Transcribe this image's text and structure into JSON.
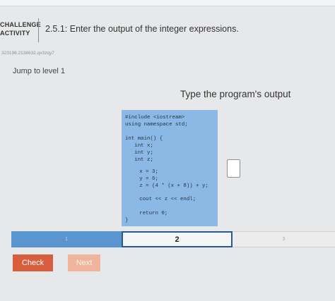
{
  "header": {
    "activity_type_line1": "CHALLENGE",
    "activity_type_line2": "ACTIVITY",
    "title": "2.5.1: Enter the output of the integer expressions."
  },
  "activity_id": "323198.2138632.qx3zqy7",
  "jump_link": "Jump to level 1",
  "prompt_label": "Type the program's output",
  "code": {
    "line1": "#include <iostream>",
    "line2": "using namespace std;",
    "line3": "int main() {",
    "line4": "   int x;",
    "line5": "   int y;",
    "line6": "   int z;",
    "line7": "   x = 3;",
    "line8": "   y = 6;",
    "line9": "   z = (4 * (x + 8)) + y;",
    "line10": "   cout << z << endl;",
    "line11": "   return 0;",
    "line12": "}"
  },
  "answer_value": "",
  "levels": [
    {
      "label": "1",
      "state": "completed"
    },
    {
      "label": "2",
      "state": "current"
    },
    {
      "label": "3",
      "state": "locked"
    }
  ],
  "buttons": {
    "check": "Check",
    "next": "Next"
  },
  "colors": {
    "code_background": "#8bb8e4",
    "level_completed": "#5b95d0",
    "level_current_border": "#2b5a8a",
    "check_button": "#d85d3c",
    "next_button_disabled": "#f0b49c"
  }
}
